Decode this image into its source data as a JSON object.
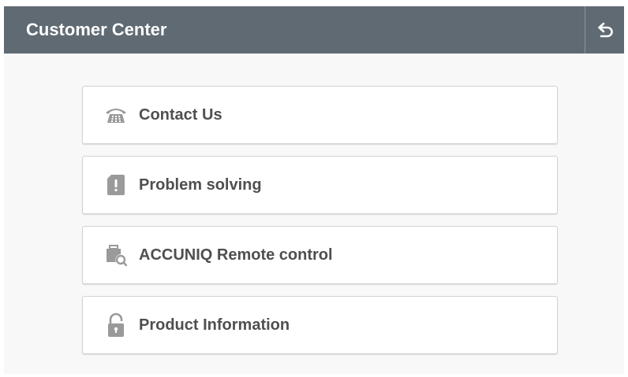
{
  "header": {
    "title": "Customer Center",
    "back_icon": "back-arrow-icon"
  },
  "menu": {
    "items": [
      {
        "label": "Contact Us",
        "icon": "telephone-icon"
      },
      {
        "label": "Problem solving",
        "icon": "alert-card-icon"
      },
      {
        "label": "ACCUNIQ Remote control",
        "icon": "remote-support-icon"
      },
      {
        "label": "Product Information",
        "icon": "lock-icon"
      }
    ]
  },
  "colors": {
    "header_bg": "#5f6a73",
    "icon_gray": "#9a9a9a",
    "label_text": "#4f4f4f"
  }
}
